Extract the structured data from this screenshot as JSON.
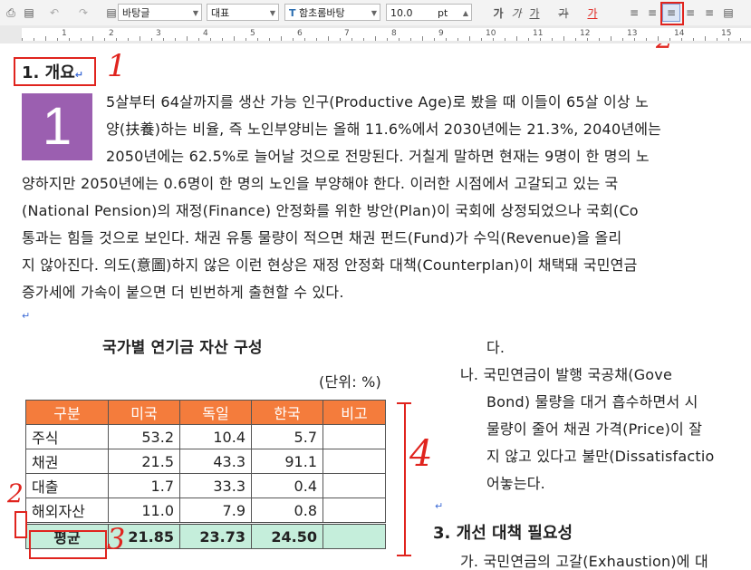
{
  "toolbar": {
    "style_name": "바탕글",
    "lang": "대표",
    "font_name": "함초롬바탕",
    "font_size": "10.0",
    "font_unit": "pt",
    "bold_glyph": "가",
    "italic_glyph": "가",
    "underline_glyph": "가",
    "strike_glyph": "가",
    "color_glyph": "가"
  },
  "ruler": {
    "numbers": [
      "1",
      "2",
      "3",
      "4",
      "5",
      "6",
      "7",
      "8",
      "9",
      "10",
      "11",
      "12",
      "13",
      "14",
      "15"
    ]
  },
  "doc": {
    "heading1": "1. 개요",
    "dropcap": "1",
    "para_lines": [
      "5살부터 64살까지를 생산 가능 인구(Productive Age)로 봤을 때 이들이 65살 이상 노",
      "양(扶養)하는 비율, 즉 노인부양비는 올해 11.6%에서 2030년에는 21.3%, 2040년에는",
      "2050년에는 62.5%로 늘어날 것으로 전망된다. 거칠게 말하면 현재는 9명이 한 명의 노",
      "양하지만 2050년에는 0.6명이 한 명의 노인을 부양해야 한다. 이러한 시점에서 고갈되고 있는 국",
      "(National Pension)의 재정(Finance) 안정화를 위한 방안(Plan)이 국회에 상정되었으나 국회(Co",
      "통과는 힘들 것으로 보인다. 채권 유통 물량이 적으면 채권 펀드(Fund)가 수익(Revenue)을 올리",
      "지 않아진다. 의도(意圖)하지 않은 이런 현상은 재정 안정화 대책(Counterplan)이 채택돼 국민연금",
      "증가세에 가속이 붙으면 더 빈번하게 출현할 수 있다."
    ],
    "table_title": "국가별 연기금 자산 구성",
    "table_unit": "(단위: %)",
    "table": {
      "headers": [
        "구분",
        "미국",
        "독일",
        "한국",
        "비고"
      ],
      "rows": [
        [
          "주식",
          "53.2",
          "10.4",
          "5.7",
          ""
        ],
        [
          "채권",
          "21.5",
          "43.3",
          "91.1",
          ""
        ],
        [
          "대출",
          "1.7",
          "33.3",
          "0.4",
          ""
        ],
        [
          "해외자산",
          "11.0",
          "7.9",
          "0.8",
          ""
        ]
      ],
      "avg_row": [
        "평균",
        "21.85",
        "23.73",
        "24.50",
        ""
      ]
    },
    "right_col": {
      "line0": "다.",
      "item_na": [
        "나. 국민연금이   발행   국공채(Gove",
        "Bond) 물량을 대거 흡수하면서 시",
        "물량이 줄어 채권 가격(Price)이 잘",
        "지 않고 있다고 불만(Dissatisfactio",
        "어놓는다."
      ],
      "heading3": "3. 개선 대책 필요성",
      "item_ga": "가. 국민연금의 고갈(Exhaustion)에 대"
    }
  },
  "annotations": {
    "n1": "1",
    "n2_top": "2",
    "n2_left": "2",
    "n3": "3",
    "n4": "4"
  },
  "colors": {
    "header_bg": "#f47c3c",
    "avg_bg": "#c5eedb",
    "dropcap_bg": "#9b5fb0",
    "annotation": "#e0241e"
  }
}
